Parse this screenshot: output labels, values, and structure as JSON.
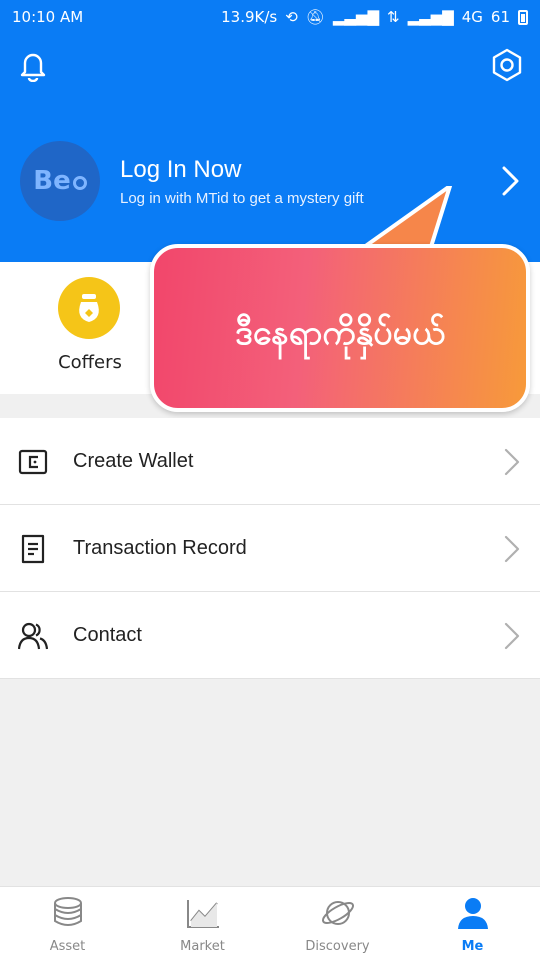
{
  "status": {
    "time": "10:10 AM",
    "speed": "13.9K/s",
    "network": "4G",
    "battery": "61"
  },
  "header": {
    "login_title": "Log In Now",
    "login_subtitle": "Log in with MTid to get a mystery gift",
    "avatar_text": "Be"
  },
  "coffers": {
    "label": "Coffers"
  },
  "promo": {
    "text": "ဒီနေရာကိုနှိပ်မယ်"
  },
  "menu": {
    "items": [
      {
        "label": "Create Wallet",
        "icon": "wallet-icon"
      },
      {
        "label": "Transaction Record",
        "icon": "document-icon"
      },
      {
        "label": "Contact",
        "icon": "contacts-icon"
      }
    ]
  },
  "tabs": [
    {
      "label": "Asset",
      "icon": "coins-stack-icon"
    },
    {
      "label": "Market",
      "icon": "chart-icon"
    },
    {
      "label": "Discovery",
      "icon": "planet-icon"
    },
    {
      "label": "Me",
      "icon": "person-icon"
    }
  ],
  "colors": {
    "primary": "#0a7cf5",
    "coffers": "#f5c518",
    "promo_start": "#f2466b",
    "promo_end": "#f79a3a"
  }
}
